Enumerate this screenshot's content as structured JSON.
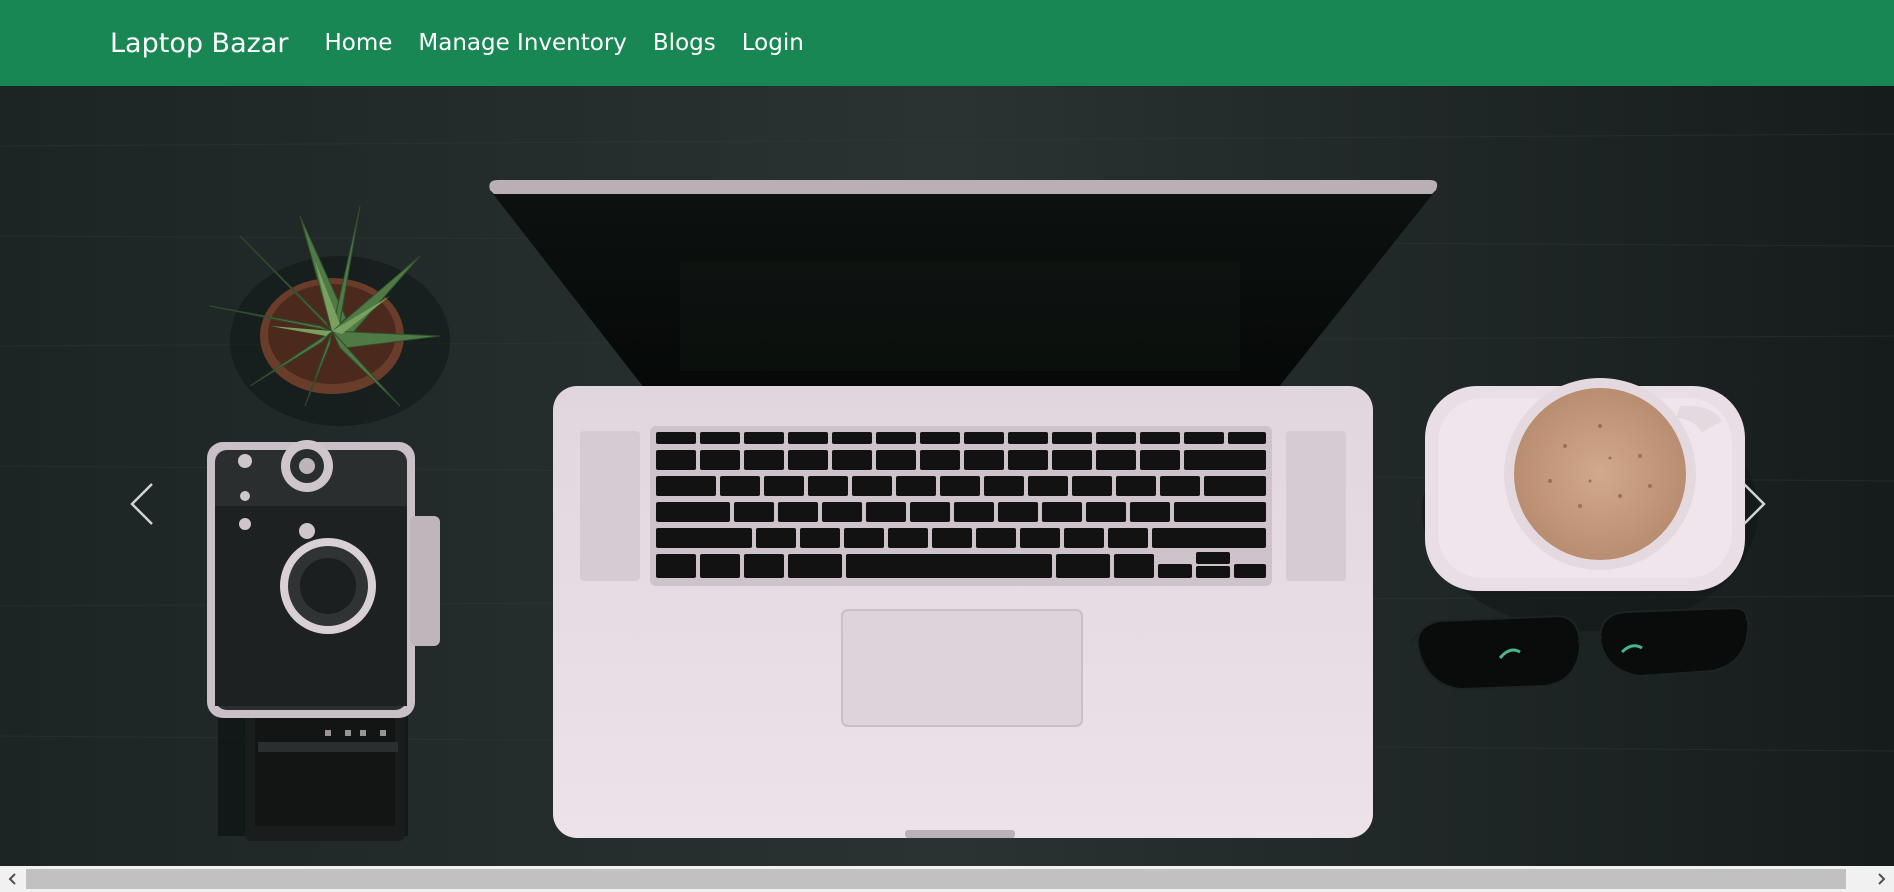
{
  "navbar": {
    "brand": "Laptop Bazar",
    "links": [
      {
        "label": "Home"
      },
      {
        "label": "Manage Inventory"
      },
      {
        "label": "Blogs"
      },
      {
        "label": "Login"
      }
    ],
    "background_color": "#198754"
  },
  "carousel": {
    "slide_image": "laptop-desk-photo",
    "controls": {
      "prev_icon": "chevron-left-icon",
      "next_icon": "chevron-right-icon"
    }
  },
  "scrollbar": {
    "left_icon": "arrow-left-icon",
    "right_icon": "arrow-right-icon"
  }
}
